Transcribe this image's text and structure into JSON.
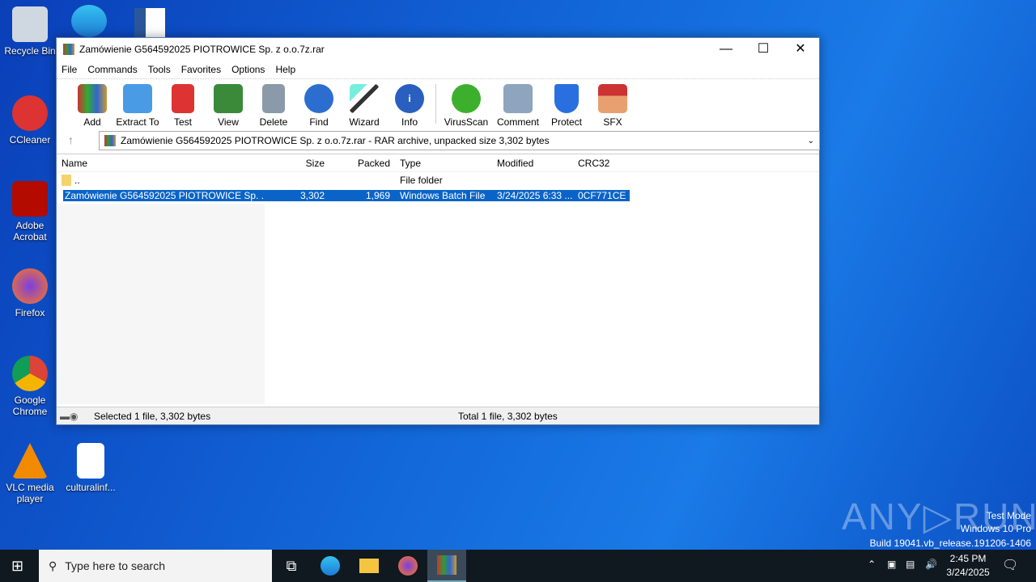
{
  "desktop": {
    "icons": [
      {
        "label": "Recycle Bin"
      },
      {
        "label": "CCleaner"
      },
      {
        "label": "Adobe Acrobat"
      },
      {
        "label": "Firefox"
      },
      {
        "label": "Google Chrome"
      },
      {
        "label": "VLC media player"
      },
      {
        "label": "culturalinf..."
      }
    ]
  },
  "window": {
    "title": "Zamówienie G564592025 PIOTROWICE Sp. z o.o.7z.rar",
    "menu": [
      "File",
      "Commands",
      "Tools",
      "Favorites",
      "Options",
      "Help"
    ],
    "toolbar": [
      "Add",
      "Extract To",
      "Test",
      "View",
      "Delete",
      "Find",
      "Wizard",
      "Info",
      "VirusScan",
      "Comment",
      "Protect",
      "SFX"
    ],
    "address": "Zamówienie G564592025 PIOTROWICE Sp. z o.o.7z.rar - RAR archive, unpacked size 3,302 bytes",
    "columns": [
      "Name",
      "Size",
      "Packed",
      "Type",
      "Modified",
      "CRC32"
    ],
    "rows": [
      [
        "..",
        "",
        "",
        "File folder",
        "",
        ""
      ],
      [
        "Zamówienie G564592025 PIOTROWICE Sp. ...",
        "3,302",
        "1,969",
        "Windows Batch File",
        "3/24/2025 6:33 ...",
        "0CF771CE"
      ]
    ],
    "status_left": "Selected 1 file, 3,302 bytes",
    "status_right": "Total 1 file, 3,302 bytes"
  },
  "watermark": {
    "brand": "ANY RUN",
    "line1": "Test Mode",
    "line2": "Windows 10 Pro",
    "line3": "Build 19041.vb_release.191206-1406"
  },
  "taskbar": {
    "search_placeholder": "Type here to search",
    "time": "2:45 PM",
    "date": "3/24/2025"
  }
}
